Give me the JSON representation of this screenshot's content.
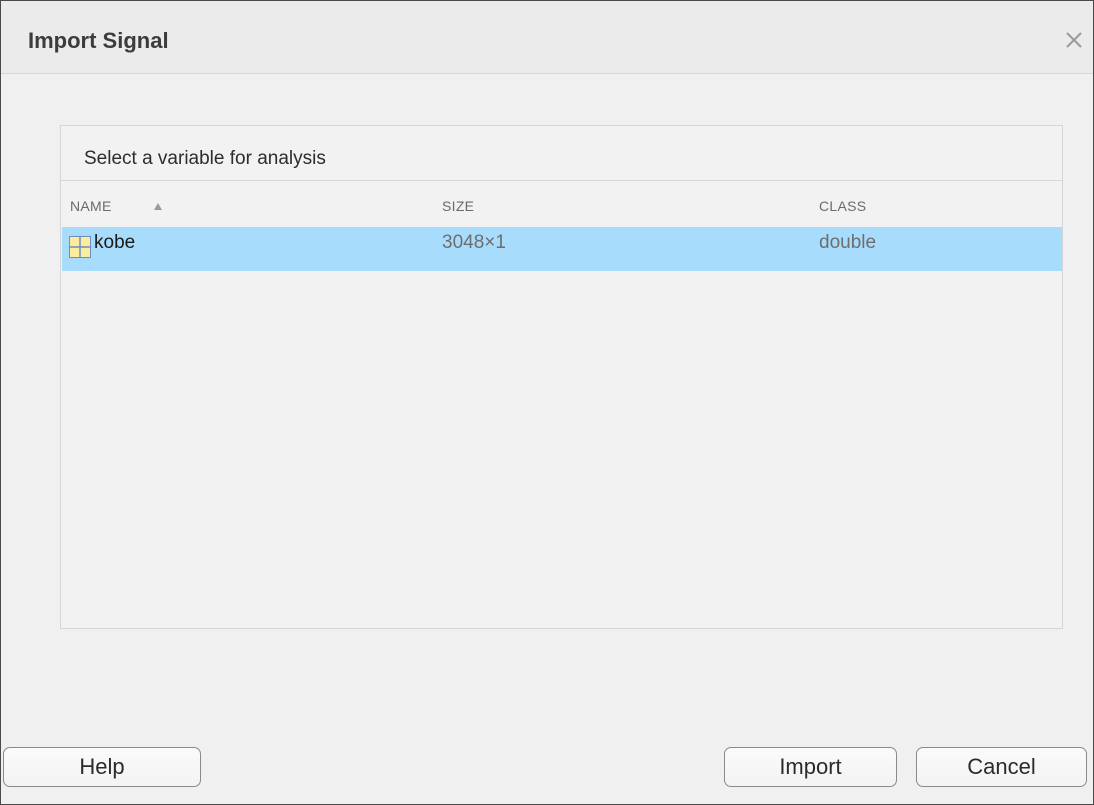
{
  "dialog": {
    "title": "Import Signal"
  },
  "panel": {
    "heading": "Select a variable for analysis",
    "columns": {
      "name": "NAME",
      "size": "SIZE",
      "class": "CLASS"
    },
    "rows": [
      {
        "name": "kobe",
        "size": "3048×1",
        "class": "double",
        "selected": true
      }
    ]
  },
  "buttons": {
    "help": "Help",
    "import": "Import",
    "cancel": "Cancel"
  },
  "icons": {
    "close": "close-icon",
    "sort": "sort-ascending-icon",
    "variable": "matrix-variable-icon"
  },
  "colors": {
    "selection": "#a8dcfd",
    "matrix_icon_fill": "#fdeba0"
  }
}
